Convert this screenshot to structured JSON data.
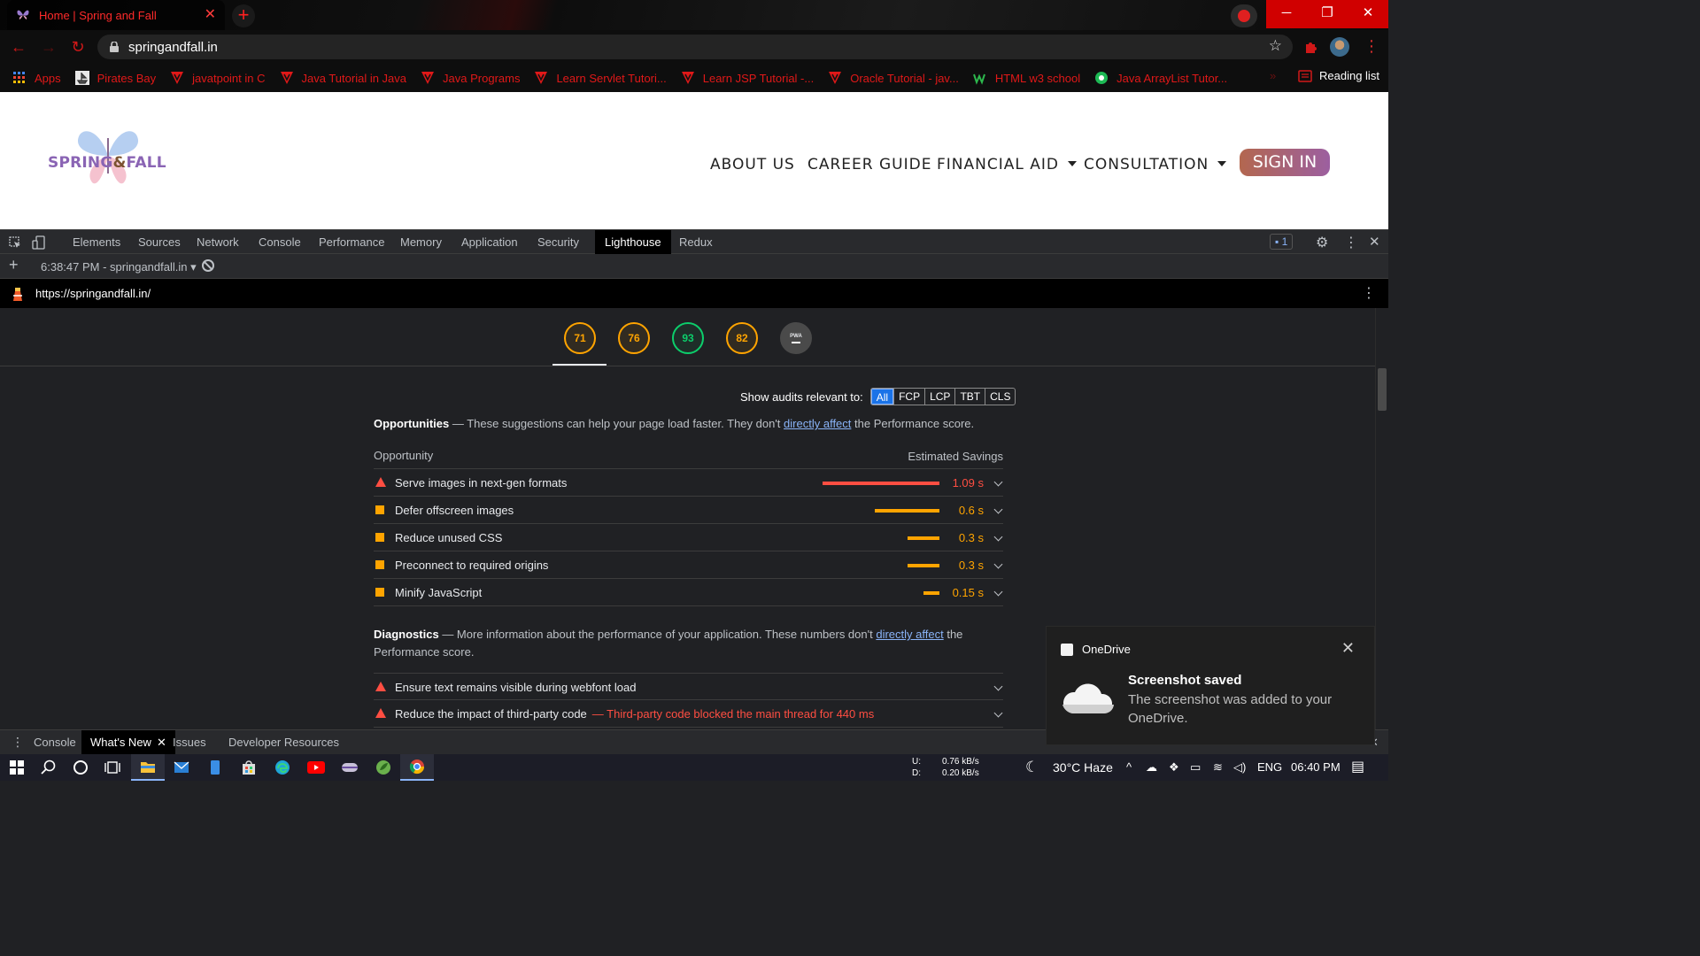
{
  "browser": {
    "tab": {
      "title": "Home | Spring and Fall"
    },
    "url": "springandfall.in",
    "window_controls": [
      "─",
      "❐",
      "✕"
    ],
    "bookmarks": [
      {
        "label": "Apps",
        "icon": "apps-grid-icon"
      },
      {
        "label": "Pirates Bay",
        "icon": "pirate-ship-icon"
      },
      {
        "label": "javatpoint in C",
        "icon": "vivaldi-icon"
      },
      {
        "label": "Java Tutorial in Java",
        "icon": "vivaldi-icon"
      },
      {
        "label": "Java Programs",
        "icon": "vivaldi-icon"
      },
      {
        "label": "Learn Servlet Tutori...",
        "icon": "vivaldi-icon"
      },
      {
        "label": "Learn JSP Tutorial -...",
        "icon": "vivaldi-icon"
      },
      {
        "label": "Oracle Tutorial - jav...",
        "icon": "vivaldi-icon"
      },
      {
        "label": "HTML w3 school",
        "icon": "w3schools-icon"
      },
      {
        "label": "Java ArrayList Tutor...",
        "icon": "green-circle-icon"
      }
    ],
    "reading_list": "Reading list"
  },
  "site": {
    "logo": {
      "part1": "SPRING",
      "amp": "&",
      "part2": "FALL"
    },
    "nav": {
      "about": "ABOUT US",
      "career": "CAREER GUIDE",
      "financial": "FINANCIAL AID",
      "consultation": "CONSULTATION",
      "signin": "SIGN IN"
    }
  },
  "devtools": {
    "tabs": [
      "Elements",
      "Sources",
      "Network",
      "Console",
      "Performance",
      "Memory",
      "Application",
      "Security",
      "Lighthouse",
      "Redux"
    ],
    "active_tab": "Lighthouse",
    "issues_count": "1",
    "report_selector": "6:38:47 PM - springandfall.in",
    "report_url": "https://springandfall.in/",
    "scores": [
      {
        "value": "71",
        "status": "average"
      },
      {
        "value": "76",
        "status": "average"
      },
      {
        "value": "93",
        "status": "pass"
      },
      {
        "value": "82",
        "status": "average"
      }
    ],
    "pwa_label": "PWA",
    "filter": {
      "label": "Show audits relevant to:",
      "chips": [
        "All",
        "FCP",
        "LCP",
        "TBT",
        "CLS"
      ],
      "selected": "All"
    },
    "opportunities": {
      "title": "Opportunities",
      "desc_before": "— These suggestions can help your page load faster. They don't",
      "link": "directly affect",
      "desc_after": "the Performance score.",
      "col_left": "Opportunity",
      "col_right": "Estimated Savings",
      "items": [
        {
          "title": "Serve images in next-gen formats",
          "value": "1.09 s",
          "savings_s": 1.09,
          "severity": "fail"
        },
        {
          "title": "Defer offscreen images",
          "value": "0.6 s",
          "savings_s": 0.6,
          "severity": "average"
        },
        {
          "title": "Reduce unused CSS",
          "value": "0.3 s",
          "savings_s": 0.3,
          "severity": "average"
        },
        {
          "title": "Preconnect to required origins",
          "value": "0.3 s",
          "savings_s": 0.3,
          "severity": "average"
        },
        {
          "title": "Minify JavaScript",
          "value": "0.15 s",
          "savings_s": 0.15,
          "severity": "average"
        }
      ]
    },
    "diagnostics": {
      "title": "Diagnostics",
      "desc_before": "— More information about the performance of your application. These numbers don't",
      "link": "directly affect",
      "desc_after": "the Performance score.",
      "items": [
        {
          "title": "Ensure text remains visible during webfont load",
          "sub": "",
          "severity": "fail"
        },
        {
          "title": "Reduce the impact of third-party code",
          "sub": "— Third-party code blocked the main thread for 440 ms",
          "severity": "fail"
        }
      ]
    },
    "drawer_tabs": [
      "Console",
      "What's New",
      "Issues",
      "Developer Resources"
    ],
    "drawer_active": "What's New"
  },
  "toast": {
    "app": "OneDrive",
    "heading": "Screenshot saved",
    "message": "The screenshot was added to your OneDrive."
  },
  "taskbar": {
    "upload": "U:",
    "upload_rate": "0.76 kB/s",
    "download": "D:",
    "download_rate": "0.20 kB/s",
    "weather": "30°C  Haze",
    "language": "ENG",
    "time": "06:40 PM"
  },
  "colors": {
    "accent_red": "#ff2a2a",
    "lh_fail": "#ff4e42",
    "lh_average": "#ffa400",
    "lh_pass": "#0cce6b",
    "link_blue": "#8ab4f8"
  }
}
